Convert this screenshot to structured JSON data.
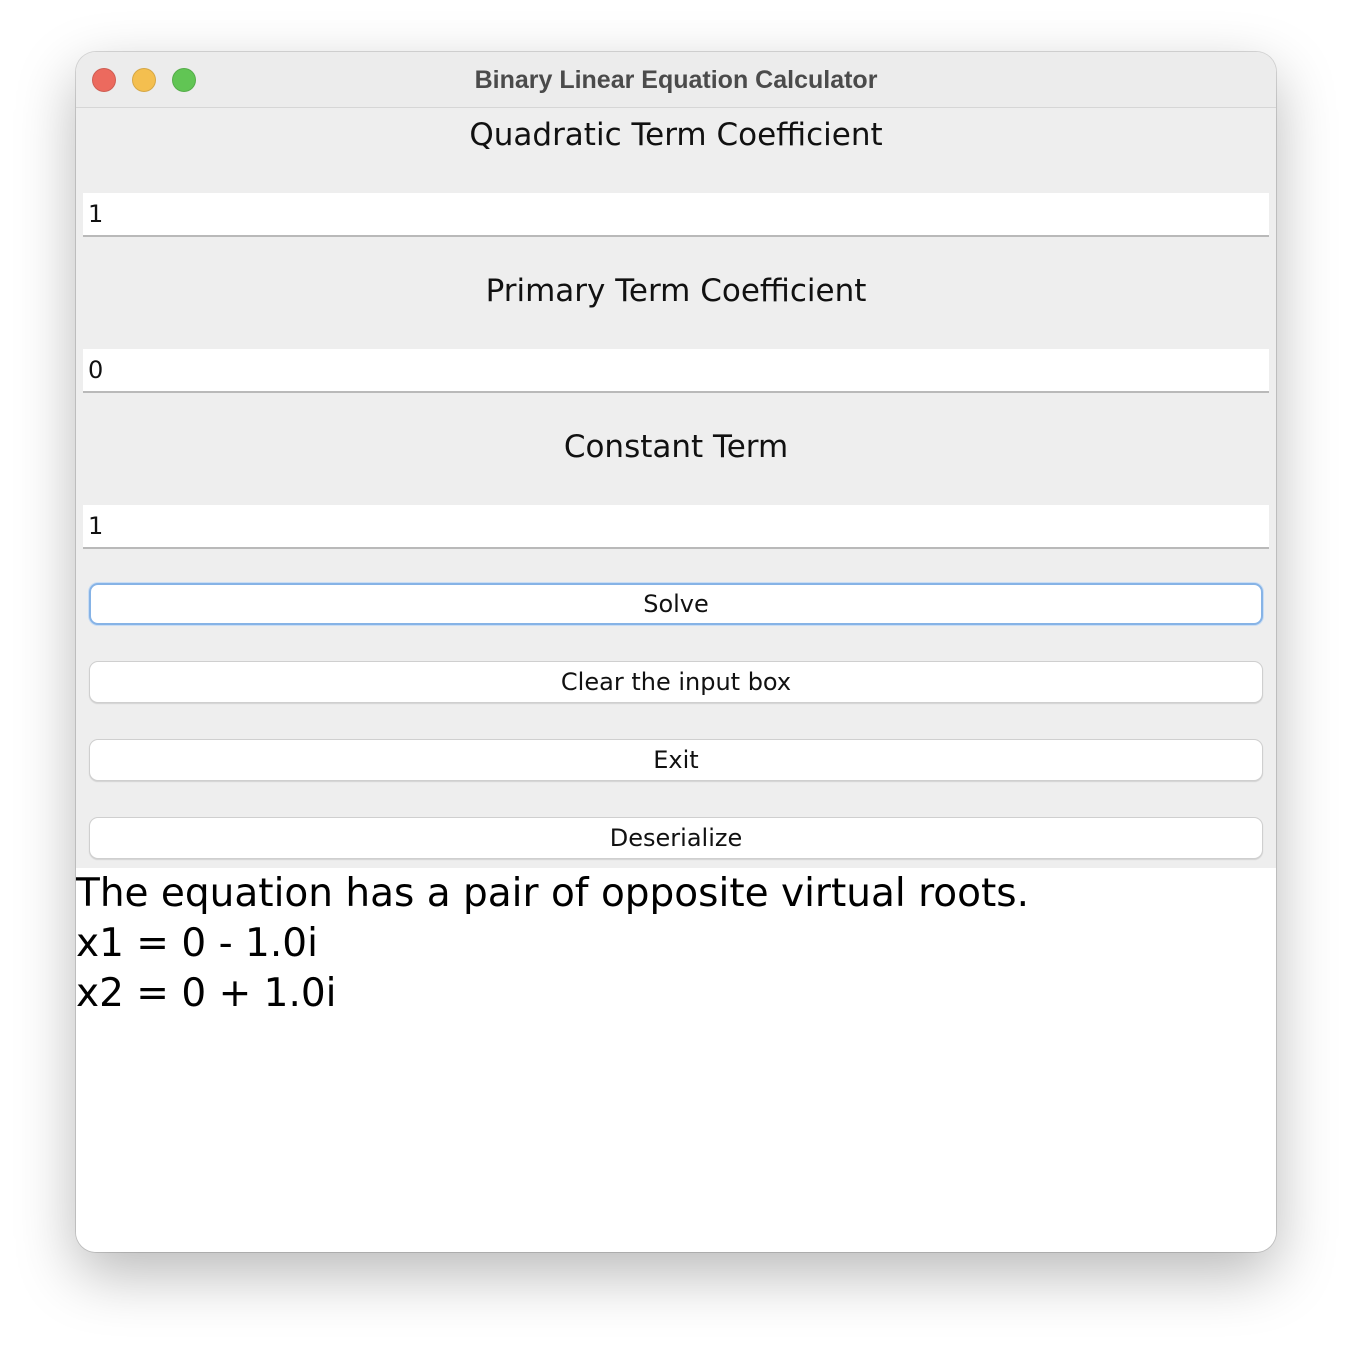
{
  "window": {
    "title": "Binary Linear Equation Calculator",
    "controls": {
      "close_color": "#ec6a5e",
      "minimize_color": "#f4bf4f",
      "zoom_color": "#61c554"
    }
  },
  "form": {
    "quadratic_label": "Quadratic Term Coefficient",
    "quadratic_value": "1",
    "primary_label": "Primary Term Coefficient",
    "primary_value": "0",
    "constant_label": "Constant Term",
    "constant_value": "1"
  },
  "buttons": {
    "solve": "Solve",
    "clear": "Clear the input box",
    "exit": "Exit",
    "deserialize": "Deserialize"
  },
  "result": {
    "lines": [
      "The equation has a pair of opposite virtual roots.",
      "x1 = 0 - 1.0i",
      "x2 = 0 + 1.0i"
    ]
  }
}
